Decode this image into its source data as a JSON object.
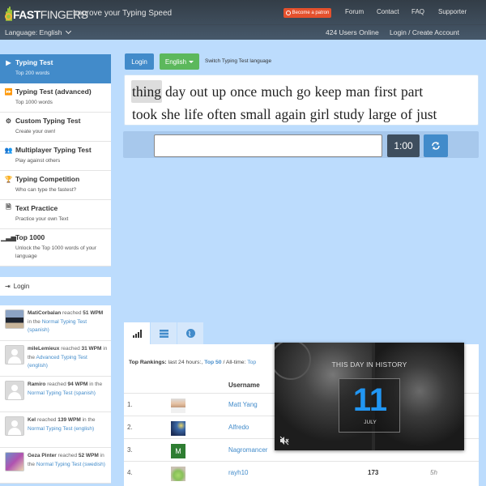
{
  "header": {
    "brand_bold": "FAST",
    "brand_thin": "FINGERS",
    "tagline": "Improve your Typing Speed",
    "patron_label": "Become a patron",
    "nav": [
      "Forum",
      "Contact",
      "FAQ",
      "Supporter"
    ],
    "language_label": "Language: English",
    "users_online": "424 Users Online",
    "login_create": "Login / Create Account"
  },
  "colors": {
    "accent_blue": "#428bca",
    "green": "#5cb85c",
    "patron_orange": "#e5512d",
    "page_bg": "#bcdcfd"
  },
  "sidebar": {
    "items": [
      {
        "title": "Typing Test",
        "sub": "Top 200 words",
        "icon": "play-icon",
        "active": true
      },
      {
        "title": "Typing Test (advanced)",
        "sub": "Top 1000 words",
        "icon": "fast-forward-icon"
      },
      {
        "title": "Custom Typing Test",
        "sub": "Create your own!",
        "icon": "cogs-icon"
      },
      {
        "title": "Multiplayer Typing Test",
        "sub": "Play against others",
        "icon": "users-icon"
      },
      {
        "title": "Typing Competition",
        "sub": "Who can type the fastest?",
        "icon": "trophy-icon"
      },
      {
        "title": "Text Practice",
        "sub": "Practice your own Text",
        "icon": "file-icon"
      },
      {
        "title": "Top 1000",
        "sub": "Unlock the Top 1000 words of your language",
        "icon": "signal-icon"
      }
    ],
    "login_label": "Login"
  },
  "activity": [
    {
      "user": "MatiCorbalan",
      "reached": "reached",
      "wpm": "51 WPM",
      "in_the": "in the",
      "test": "Normal Typing Test (spanish)"
    },
    {
      "user": "mileLemieux",
      "reached": "reached",
      "wpm": "31 WPM",
      "in_the": "in the",
      "test": "Advanced Typing Test (english)"
    },
    {
      "user": "Ramiro",
      "reached": "reached",
      "wpm": "94 WPM",
      "in_the": "in the",
      "test": "Normal Typing Test (spanish)"
    },
    {
      "user": "Kel",
      "reached": "reached",
      "wpm": "139 WPM",
      "in_the": "in the",
      "test": "Normal Typing Test (english)"
    },
    {
      "user": "Geza Pinter",
      "reached": "reached",
      "wpm": "52 WPM",
      "in_the": "in the",
      "test": "Normal Typing Test (swedish)"
    }
  ],
  "test": {
    "login_button": "Login",
    "language_button": "English",
    "switch_language_label": "Switch Typing Test language",
    "words_line1": [
      "thing",
      "day",
      "out",
      "up",
      "once",
      "much",
      "go",
      "keep",
      "man",
      "first",
      "part"
    ],
    "words_line2": [
      "took",
      "she",
      "life",
      "often",
      "small",
      "again",
      "girl",
      "study",
      "large",
      "of",
      "just"
    ],
    "current_word": "thing",
    "input_value": "",
    "timer": "1:00"
  },
  "rankings": {
    "label": "Top Rankings:",
    "last24": " last 24 hours:,",
    "top50": "Top 50",
    "alltime": " / All-time:",
    "alltime_link": "Top",
    "col_username": "Username",
    "rows": [
      {
        "rank": "1.",
        "name": "Matt Yang",
        "wpm": "",
        "time": ""
      },
      {
        "rank": "2.",
        "name": "Alfredo",
        "wpm": "",
        "time": ""
      },
      {
        "rank": "3.",
        "name": "Nagromancer",
        "wpm": "",
        "time": ""
      },
      {
        "rank": "4.",
        "name": "rayh10",
        "wpm": "173",
        "time": "5h"
      }
    ]
  },
  "video_ad": {
    "title": "THIS DAY IN HISTORY",
    "day": "11",
    "month": "JULY"
  }
}
